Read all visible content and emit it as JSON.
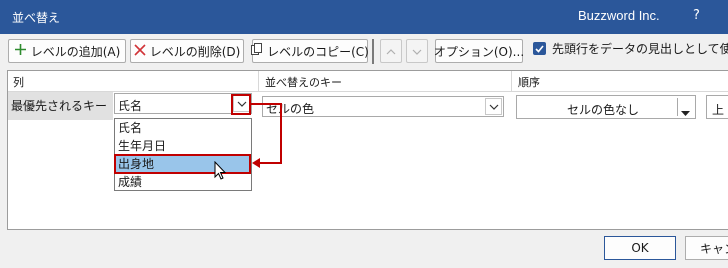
{
  "window": {
    "title": "並べ替え",
    "brand": "Buzzword Inc.",
    "help": "?"
  },
  "toolbar": {
    "add_level": "レベルの追加(A)",
    "delete_level": "レベルの削除(D)",
    "copy_level": "レベルのコピー(C)",
    "options": "オプション(O)...",
    "header_checkbox_label": "先頭行をデータの見出しとして使用す",
    "header_checkbox_checked": true
  },
  "grid": {
    "headers": {
      "column": "列",
      "sort_on": "並べ替えのキー",
      "order": "順序"
    },
    "row": {
      "label": "最優先されるキー",
      "column_value": "氏名",
      "sort_on_value": "セルの色",
      "order_value": "セルの色なし",
      "position_value": "上"
    }
  },
  "dropdown": {
    "items": [
      "氏名",
      "生年月日",
      "出身地",
      "成績"
    ],
    "selected": "出身地"
  },
  "footer": {
    "ok": "OK",
    "cancel": "キャン"
  },
  "colors": {
    "titlebar": "#2b579a",
    "highlight": "#99c5ea",
    "annotation": "#c00000"
  }
}
